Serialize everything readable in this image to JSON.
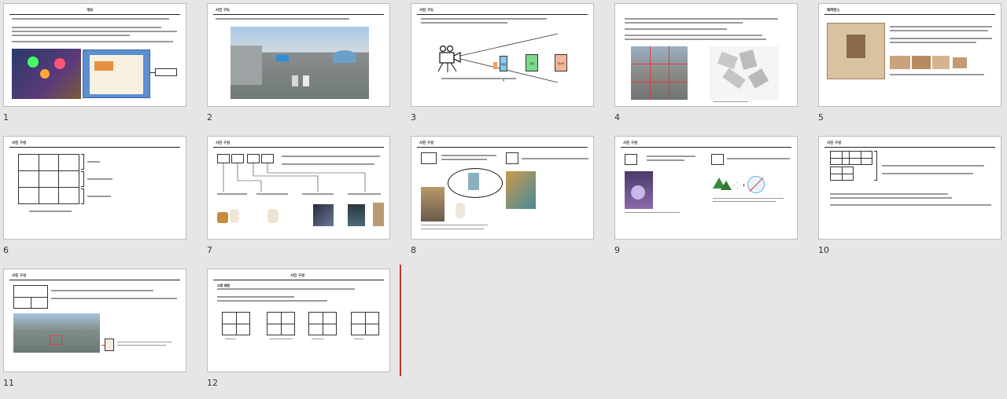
{
  "slides": [
    {
      "number": "1",
      "title": "개요"
    },
    {
      "number": "2",
      "title": "사진 구도"
    },
    {
      "number": "3",
      "title": "사진 구도"
    },
    {
      "number": "4",
      "title": ""
    },
    {
      "number": "5",
      "title": "레퍼런스"
    },
    {
      "number": "6",
      "title": "사진 구성"
    },
    {
      "number": "7",
      "title": "사진 구성"
    },
    {
      "number": "8",
      "title": "사진 구성"
    },
    {
      "number": "9",
      "title": "사진 구성"
    },
    {
      "number": "10",
      "title": "사진 구성"
    },
    {
      "number": "11",
      "title": "사진 구성"
    },
    {
      "number": "12",
      "title": "사진 구성"
    }
  ],
  "slide3": {
    "card_labels": [
      "망원경",
      "잡지",
      "현수막"
    ]
  },
  "slide12": {
    "subtitle": "고정 대한"
  },
  "accent": {
    "insert_line": "#c0392b"
  }
}
